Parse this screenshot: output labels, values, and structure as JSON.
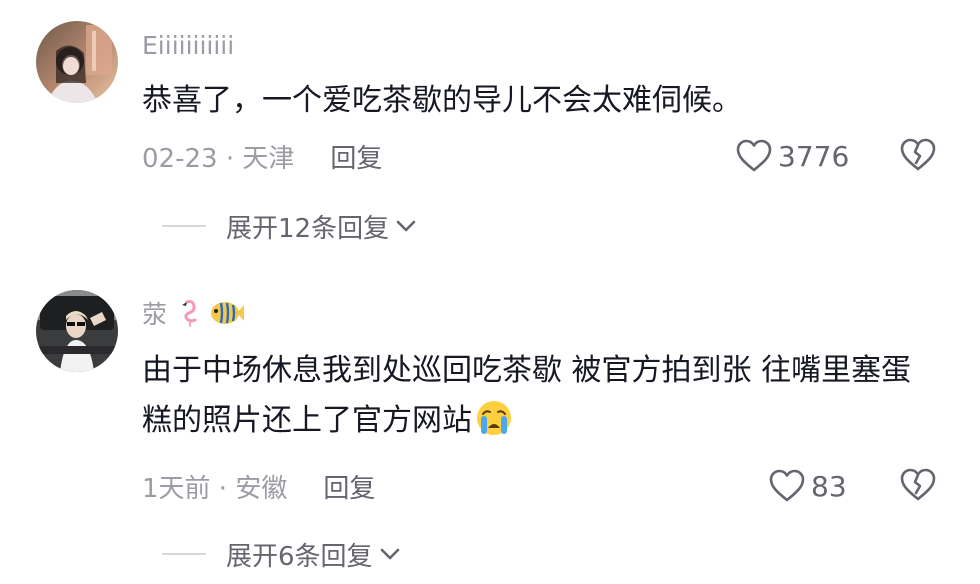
{
  "comments": [
    {
      "username": "Eiiiiiiiiiii",
      "text": "恭喜了，一个爱吃茶歇的导儿不会太难伺候。",
      "date_location": "02-23 · 天津",
      "reply_label": "回复",
      "like_count": "3776",
      "expand_label": "展开12条回复",
      "avatar_icon": "avatar-photo"
    },
    {
      "username": "荥",
      "name_icons": [
        "flamingo-icon",
        "fish-icon"
      ],
      "text": "由于中场休息我到处巡回吃茶歇 被官方拍到张 往嘴里塞蛋糕的照片还上了官方网站",
      "text_emoji": "crying-face-icon",
      "date_location": "1天前 · 安徽",
      "reply_label": "回复",
      "like_count": "83",
      "expand_label": "展开6条回复",
      "avatar_icon": "avatar-photo"
    }
  ],
  "colors": {
    "primary_text": "#161823",
    "secondary_text": "#9b9ca4",
    "tertiary_text": "#64656e",
    "divider": "#d8d8dc"
  }
}
